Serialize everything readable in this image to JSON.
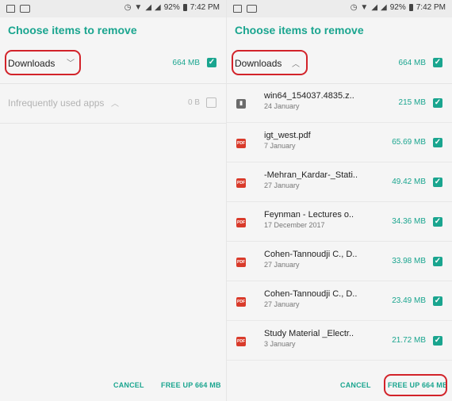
{
  "status_bar": {
    "battery": "92%",
    "time": "7:42 PM"
  },
  "title": "Choose items to remove",
  "left": {
    "categories": [
      {
        "label": "Downloads",
        "size": "664 MB",
        "checked": true
      },
      {
        "label": "Infrequently used apps",
        "size": "0 B",
        "checked": false
      }
    ],
    "cancel": "CANCEL",
    "free_up": "FREE UP 664 MB"
  },
  "right": {
    "category": {
      "label": "Downloads",
      "size": "664 MB",
      "checked": true
    },
    "files": [
      {
        "name": "win64_154037.4835.z..",
        "date": "24 January",
        "size": "215 MB",
        "type": "zip-icon"
      },
      {
        "name": "igt_west.pdf",
        "date": "7 January",
        "size": "65.69 MB",
        "type": "pdf-icon"
      },
      {
        "name": "-Mehran_Kardar-_Stati..",
        "date": "27 January",
        "size": "49.42 MB",
        "type": "pdf-icon"
      },
      {
        "name": "Feynman - Lectures o..",
        "date": "17 December 2017",
        "size": "34.36 MB",
        "type": "pdf-icon"
      },
      {
        "name": "Cohen-Tannoudji C., D..",
        "date": "27 January",
        "size": "33.98 MB",
        "type": "pdf-icon"
      },
      {
        "name": "Cohen-Tannoudji C., D..",
        "date": "27 January",
        "size": "23.49 MB",
        "type": "pdf-icon"
      },
      {
        "name": "Study Material _Electr..",
        "date": "3 January",
        "size": "21.72 MB",
        "type": "pdf-icon"
      }
    ],
    "cancel": "CANCEL",
    "free_up": "FREE UP 664 MB"
  },
  "colors": {
    "accent": "#1aa58f",
    "highlight": "#d2232a",
    "pdf": "#d93b2b"
  }
}
